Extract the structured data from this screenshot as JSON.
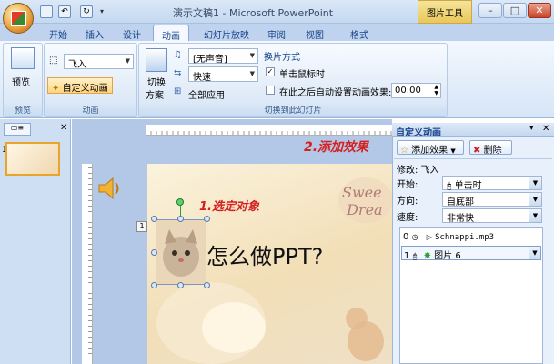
{
  "window": {
    "title": "演示文稿1 - Microsoft PowerPoint",
    "context_tab": "图片工具",
    "controls": {
      "minimize": "–",
      "maximize": "□",
      "close": "✕"
    }
  },
  "tabs": [
    {
      "label": "开始"
    },
    {
      "label": "插入"
    },
    {
      "label": "设计"
    },
    {
      "label": "动画"
    },
    {
      "label": "幻灯片放映"
    },
    {
      "label": "审阅"
    },
    {
      "label": "视图"
    },
    {
      "label": "格式"
    }
  ],
  "ribbon": {
    "preview": {
      "button": "预览",
      "group": "预览"
    },
    "animation": {
      "effect_value": "飞入",
      "custom_button": "自定义动画",
      "group": "动画"
    },
    "transition": {
      "scheme_line1": "切换",
      "scheme_line2": "方案",
      "sound_value": "[无声音]",
      "speed_value": "快速",
      "apply_all": "全部应用",
      "group": "切换到此幻灯片"
    },
    "advance": {
      "heading": "换片方式",
      "on_click": "单击鼠标时",
      "auto_label": "在此之后自动设置动画效果:",
      "auto_time": "00:00"
    }
  },
  "slide_panel": {
    "slide_number": "1"
  },
  "slide": {
    "main_text": "怎么做PPT?",
    "annotation_step1": "1.选定对象",
    "annotation_step2": "2.添加效果",
    "animation_marker": "1"
  },
  "task_pane": {
    "title": "自定义动画",
    "add_effect": "添加效果",
    "delete": "删除",
    "modify_label": "修改: 飞入",
    "start_label": "开始:",
    "start_value": "单击时",
    "direction_label": "方向:",
    "direction_value": "自底部",
    "speed_label": "速度:",
    "speed_value": "非常快",
    "items": [
      {
        "index": "0",
        "name": "Schnappi.mp3"
      },
      {
        "index": "1",
        "name": "图片 6"
      }
    ]
  },
  "colors": {
    "accent": "#15428b",
    "annotation_red": "#d42020",
    "selection_green": "#2f9e3a"
  }
}
